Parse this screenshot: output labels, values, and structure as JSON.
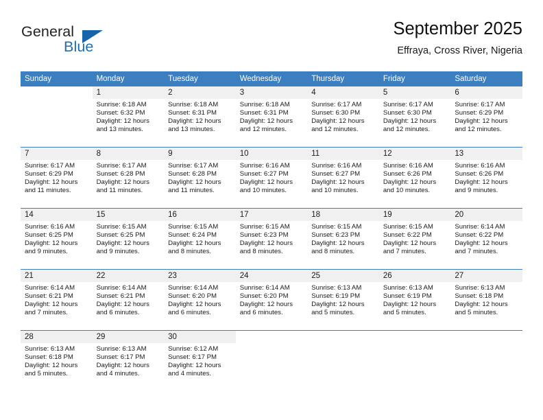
{
  "brand": {
    "name_part1": "General",
    "name_part2": "Blue",
    "flag_color": "#1665ab"
  },
  "header": {
    "title": "September 2025",
    "location": "Effraya, Cross River, Nigeria"
  },
  "theme": {
    "header_bg": "#3c7fc1",
    "daynum_bg": "#f0f0f0",
    "text": "#1a1a1a"
  },
  "weekday_headers": [
    "Sunday",
    "Monday",
    "Tuesday",
    "Wednesday",
    "Thursday",
    "Friday",
    "Saturday"
  ],
  "weeks": [
    [
      {
        "day": ""
      },
      {
        "day": "1",
        "sunrise": "Sunrise: 6:18 AM",
        "sunset": "Sunset: 6:32 PM",
        "daylight_line1": "Daylight: 12 hours",
        "daylight_line2": "and 13 minutes."
      },
      {
        "day": "2",
        "sunrise": "Sunrise: 6:18 AM",
        "sunset": "Sunset: 6:31 PM",
        "daylight_line1": "Daylight: 12 hours",
        "daylight_line2": "and 13 minutes."
      },
      {
        "day": "3",
        "sunrise": "Sunrise: 6:18 AM",
        "sunset": "Sunset: 6:31 PM",
        "daylight_line1": "Daylight: 12 hours",
        "daylight_line2": "and 12 minutes."
      },
      {
        "day": "4",
        "sunrise": "Sunrise: 6:17 AM",
        "sunset": "Sunset: 6:30 PM",
        "daylight_line1": "Daylight: 12 hours",
        "daylight_line2": "and 12 minutes."
      },
      {
        "day": "5",
        "sunrise": "Sunrise: 6:17 AM",
        "sunset": "Sunset: 6:30 PM",
        "daylight_line1": "Daylight: 12 hours",
        "daylight_line2": "and 12 minutes."
      },
      {
        "day": "6",
        "sunrise": "Sunrise: 6:17 AM",
        "sunset": "Sunset: 6:29 PM",
        "daylight_line1": "Daylight: 12 hours",
        "daylight_line2": "and 12 minutes."
      }
    ],
    [
      {
        "day": "7",
        "sunrise": "Sunrise: 6:17 AM",
        "sunset": "Sunset: 6:29 PM",
        "daylight_line1": "Daylight: 12 hours",
        "daylight_line2": "and 11 minutes."
      },
      {
        "day": "8",
        "sunrise": "Sunrise: 6:17 AM",
        "sunset": "Sunset: 6:28 PM",
        "daylight_line1": "Daylight: 12 hours",
        "daylight_line2": "and 11 minutes."
      },
      {
        "day": "9",
        "sunrise": "Sunrise: 6:17 AM",
        "sunset": "Sunset: 6:28 PM",
        "daylight_line1": "Daylight: 12 hours",
        "daylight_line2": "and 11 minutes."
      },
      {
        "day": "10",
        "sunrise": "Sunrise: 6:16 AM",
        "sunset": "Sunset: 6:27 PM",
        "daylight_line1": "Daylight: 12 hours",
        "daylight_line2": "and 10 minutes."
      },
      {
        "day": "11",
        "sunrise": "Sunrise: 6:16 AM",
        "sunset": "Sunset: 6:27 PM",
        "daylight_line1": "Daylight: 12 hours",
        "daylight_line2": "and 10 minutes."
      },
      {
        "day": "12",
        "sunrise": "Sunrise: 6:16 AM",
        "sunset": "Sunset: 6:26 PM",
        "daylight_line1": "Daylight: 12 hours",
        "daylight_line2": "and 10 minutes."
      },
      {
        "day": "13",
        "sunrise": "Sunrise: 6:16 AM",
        "sunset": "Sunset: 6:26 PM",
        "daylight_line1": "Daylight: 12 hours",
        "daylight_line2": "and 9 minutes."
      }
    ],
    [
      {
        "day": "14",
        "sunrise": "Sunrise: 6:16 AM",
        "sunset": "Sunset: 6:25 PM",
        "daylight_line1": "Daylight: 12 hours",
        "daylight_line2": "and 9 minutes."
      },
      {
        "day": "15",
        "sunrise": "Sunrise: 6:15 AM",
        "sunset": "Sunset: 6:25 PM",
        "daylight_line1": "Daylight: 12 hours",
        "daylight_line2": "and 9 minutes."
      },
      {
        "day": "16",
        "sunrise": "Sunrise: 6:15 AM",
        "sunset": "Sunset: 6:24 PM",
        "daylight_line1": "Daylight: 12 hours",
        "daylight_line2": "and 8 minutes."
      },
      {
        "day": "17",
        "sunrise": "Sunrise: 6:15 AM",
        "sunset": "Sunset: 6:23 PM",
        "daylight_line1": "Daylight: 12 hours",
        "daylight_line2": "and 8 minutes."
      },
      {
        "day": "18",
        "sunrise": "Sunrise: 6:15 AM",
        "sunset": "Sunset: 6:23 PM",
        "daylight_line1": "Daylight: 12 hours",
        "daylight_line2": "and 8 minutes."
      },
      {
        "day": "19",
        "sunrise": "Sunrise: 6:15 AM",
        "sunset": "Sunset: 6:22 PM",
        "daylight_line1": "Daylight: 12 hours",
        "daylight_line2": "and 7 minutes."
      },
      {
        "day": "20",
        "sunrise": "Sunrise: 6:14 AM",
        "sunset": "Sunset: 6:22 PM",
        "daylight_line1": "Daylight: 12 hours",
        "daylight_line2": "and 7 minutes."
      }
    ],
    [
      {
        "day": "21",
        "sunrise": "Sunrise: 6:14 AM",
        "sunset": "Sunset: 6:21 PM",
        "daylight_line1": "Daylight: 12 hours",
        "daylight_line2": "and 7 minutes."
      },
      {
        "day": "22",
        "sunrise": "Sunrise: 6:14 AM",
        "sunset": "Sunset: 6:21 PM",
        "daylight_line1": "Daylight: 12 hours",
        "daylight_line2": "and 6 minutes."
      },
      {
        "day": "23",
        "sunrise": "Sunrise: 6:14 AM",
        "sunset": "Sunset: 6:20 PM",
        "daylight_line1": "Daylight: 12 hours",
        "daylight_line2": "and 6 minutes."
      },
      {
        "day": "24",
        "sunrise": "Sunrise: 6:14 AM",
        "sunset": "Sunset: 6:20 PM",
        "daylight_line1": "Daylight: 12 hours",
        "daylight_line2": "and 6 minutes."
      },
      {
        "day": "25",
        "sunrise": "Sunrise: 6:13 AM",
        "sunset": "Sunset: 6:19 PM",
        "daylight_line1": "Daylight: 12 hours",
        "daylight_line2": "and 5 minutes."
      },
      {
        "day": "26",
        "sunrise": "Sunrise: 6:13 AM",
        "sunset": "Sunset: 6:19 PM",
        "daylight_line1": "Daylight: 12 hours",
        "daylight_line2": "and 5 minutes."
      },
      {
        "day": "27",
        "sunrise": "Sunrise: 6:13 AM",
        "sunset": "Sunset: 6:18 PM",
        "daylight_line1": "Daylight: 12 hours",
        "daylight_line2": "and 5 minutes."
      }
    ],
    [
      {
        "day": "28",
        "sunrise": "Sunrise: 6:13 AM",
        "sunset": "Sunset: 6:18 PM",
        "daylight_line1": "Daylight: 12 hours",
        "daylight_line2": "and 5 minutes."
      },
      {
        "day": "29",
        "sunrise": "Sunrise: 6:13 AM",
        "sunset": "Sunset: 6:17 PM",
        "daylight_line1": "Daylight: 12 hours",
        "daylight_line2": "and 4 minutes."
      },
      {
        "day": "30",
        "sunrise": "Sunrise: 6:12 AM",
        "sunset": "Sunset: 6:17 PM",
        "daylight_line1": "Daylight: 12 hours",
        "daylight_line2": "and 4 minutes."
      },
      {
        "day": ""
      },
      {
        "day": ""
      },
      {
        "day": ""
      },
      {
        "day": ""
      }
    ]
  ]
}
